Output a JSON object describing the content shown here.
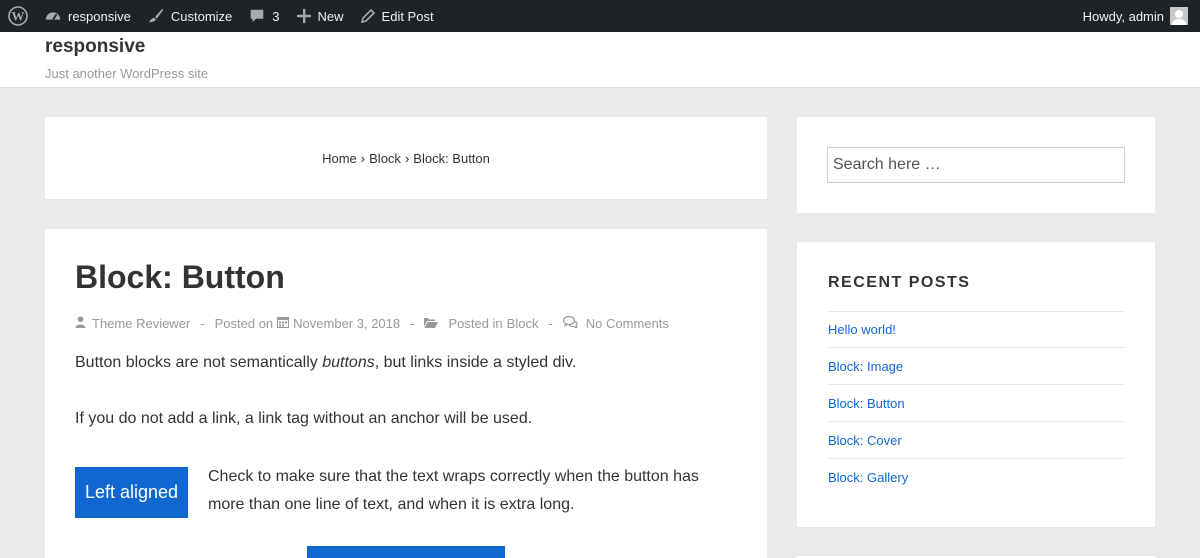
{
  "adminbar": {
    "site_name": "responsive",
    "customize": "Customize",
    "comments_count": "3",
    "new": "New",
    "edit_post": "Edit Post",
    "howdy": "Howdy, admin"
  },
  "header": {
    "site_title": "responsive",
    "tagline": "Just another WordPress site"
  },
  "breadcrumb": {
    "home": "Home",
    "sep": "›",
    "category": "Block",
    "current": "Block: Button"
  },
  "post": {
    "title": "Block: Button",
    "author": "Theme Reviewer",
    "posted_on_label": "Posted on",
    "date": "November 3, 2018",
    "posted_in_label": "Posted in",
    "category": "Block",
    "comments": "No Comments",
    "dash": "-",
    "p1_before": "Button blocks are not semantically ",
    "p1_em": "buttons",
    "p1_after": ", but links inside a styled div.",
    "p2": "If you do not add a link, a link tag without an anchor will be used.",
    "button_left_label": "Left aligned",
    "wrap_text": "Check to make sure that the text wraps correctly when the button has more than one line of text, and when it is extra long."
  },
  "sidebar": {
    "search_placeholder": "Search here …",
    "recent_title": "RECENT POSTS",
    "recent_posts": [
      {
        "label": "Hello world!"
      },
      {
        "label": "Block: Image"
      },
      {
        "label": "Block: Button"
      },
      {
        "label": "Block: Cover"
      },
      {
        "label": "Block: Gallery"
      }
    ]
  },
  "colors": {
    "adminbar_bg": "#1d2327",
    "accent": "#1067cf",
    "page_bg": "#eaeaea"
  }
}
